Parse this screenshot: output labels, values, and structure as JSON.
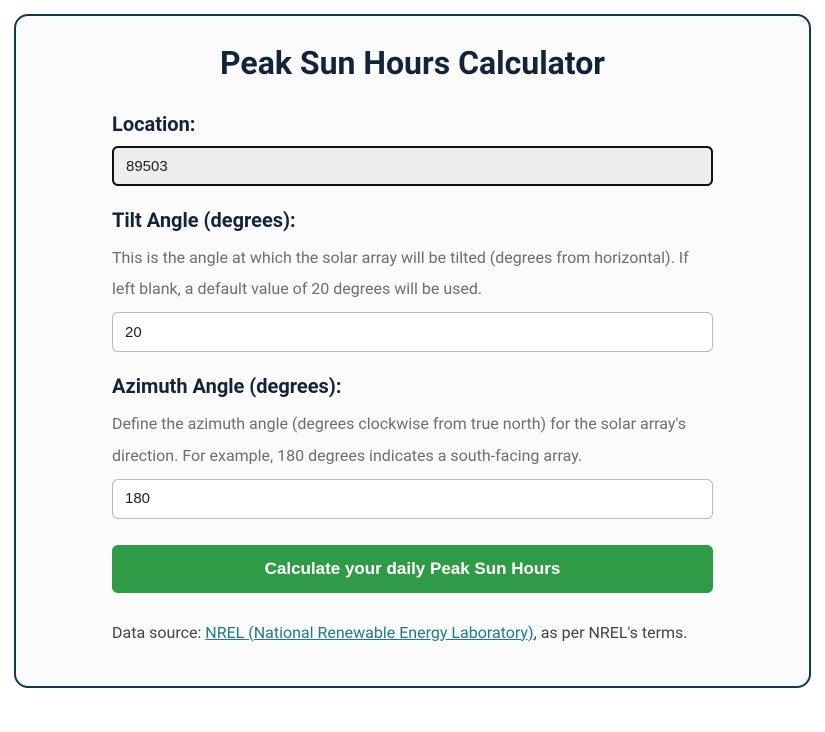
{
  "title": "Peak Sun Hours Calculator",
  "location": {
    "label": "Location:",
    "value": "89503"
  },
  "tilt": {
    "label": "Tilt Angle (degrees):",
    "description": "This is the angle at which the solar array will be tilted (degrees from horizontal). If left blank, a default value of 20 degrees will be used.",
    "value": "20"
  },
  "azimuth": {
    "label": "Azimuth Angle (degrees):",
    "description": "Define the azimuth angle (degrees clockwise from true north) for the solar array's direction. For example, 180 degrees indicates a south-facing array.",
    "value": "180"
  },
  "button": {
    "label": "Calculate your daily Peak Sun Hours"
  },
  "footer": {
    "prefix": "Data source: ",
    "link_text": "NREL (National Renewable Energy Laboratory)",
    "suffix": ", as per NREL's terms."
  }
}
